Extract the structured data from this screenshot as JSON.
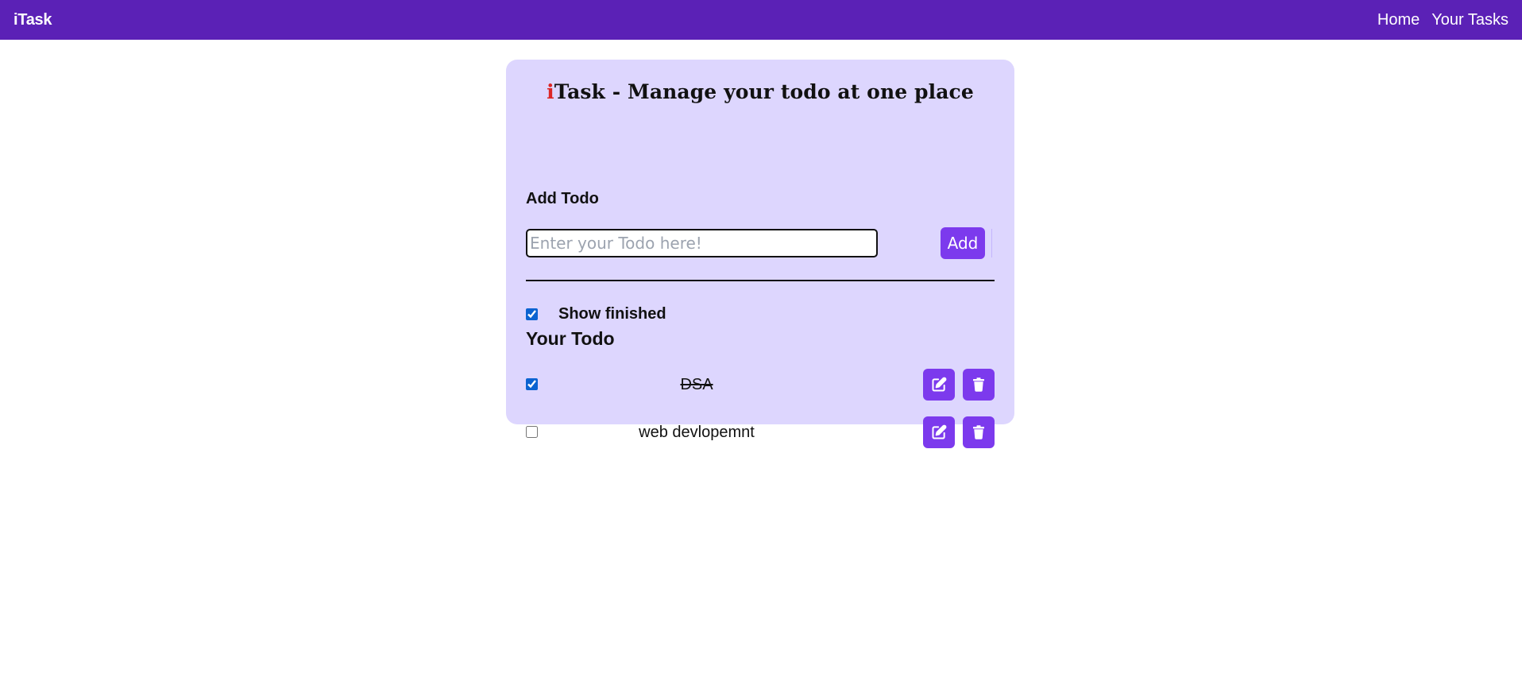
{
  "navbar": {
    "brand": "iTask",
    "links": [
      "Home",
      "Your Tasks"
    ]
  },
  "card": {
    "title_accent": "i",
    "title_rest": "Task - Manage your todo at one place",
    "add_section_heading": "Add Todo",
    "input": {
      "placeholder": "Enter your Todo here!",
      "value": ""
    },
    "add_button_label": "Add",
    "show_finished": {
      "label": "Show finished",
      "checked": true
    },
    "list_heading": "Your Todo",
    "todos": [
      {
        "text": "DSA",
        "completed": true
      },
      {
        "text": "web devlopemnt",
        "completed": false
      }
    ]
  },
  "icons": {
    "edit": "edit-icon",
    "delete": "trash-icon"
  },
  "colors": {
    "navbar_bg": "#5b21b6",
    "card_bg": "#ddd6fe",
    "button_bg": "#7c3aed",
    "title_accent": "#dc2626"
  }
}
